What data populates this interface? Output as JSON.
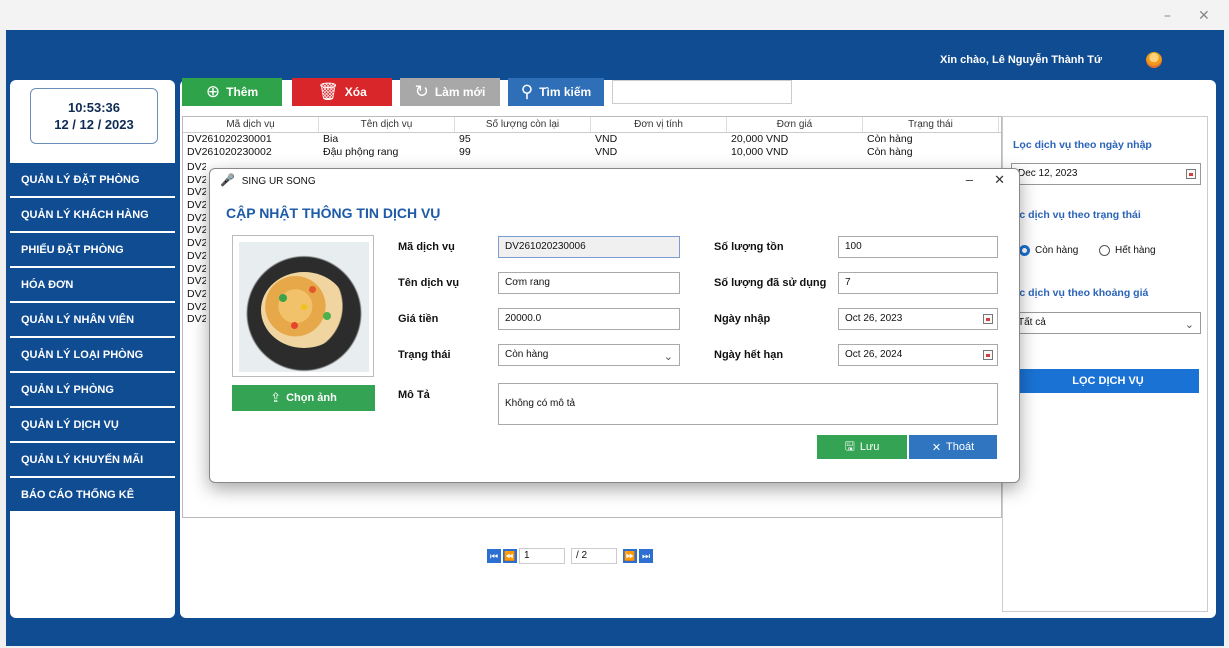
{
  "window": {
    "minimize": "–",
    "close": "✕"
  },
  "header": {
    "greeting": "Xin chào,",
    "user_name": "Lê Nguyễn Thành Tứ"
  },
  "clock": {
    "time": "10:53:36",
    "date": "12 / 12 / 2023"
  },
  "sidebar": {
    "items": [
      {
        "label": "QUẢN LÝ ĐẶT PHÒNG"
      },
      {
        "label": "QUẢN LÝ KHÁCH HÀNG"
      },
      {
        "label": "PHIẾU ĐẶT PHÒNG"
      },
      {
        "label": "HÓA ĐƠN"
      },
      {
        "label": "QUẢN LÝ NHÂN VIÊN"
      },
      {
        "label": "QUẢN LÝ LOẠI PHÒNG"
      },
      {
        "label": "QUẢN LÝ PHÒNG"
      },
      {
        "label": "QUẢN LÝ DỊCH VỤ"
      },
      {
        "label": "QUẢN LÝ KHUYẾN MÃI"
      },
      {
        "label": "BÁO CÁO THỐNG KÊ"
      }
    ]
  },
  "toolbar": {
    "add_label": "Thêm",
    "delete_label": "Xóa",
    "refresh_label": "Làm mới",
    "search_label": "Tìm kiếm",
    "search_value": ""
  },
  "table": {
    "headers": [
      "Mã dịch vụ",
      "Tên dịch vụ",
      "Số lượng còn lại",
      "Đơn vị tính",
      "Đơn giá",
      "Trạng thái"
    ],
    "rows": [
      [
        "DV261020230001",
        "Bia",
        "95",
        "VND",
        "20,000 VND",
        "Còn hàng"
      ],
      [
        "DV261020230002",
        "Đậu phộng rang",
        "99",
        "VND",
        "10,000 VND",
        "Còn hàng"
      ]
    ],
    "partial_ids": [
      "DV26",
      "DV26",
      "DV26",
      "DV26",
      "DV26",
      "DV26",
      "DV27",
      "DV27",
      "DV27",
      "DV27",
      "DV27",
      "DV27",
      "DV27"
    ]
  },
  "pagination": {
    "current": "1",
    "total": "/ 2"
  },
  "filter": {
    "by_date_title": "Lọc dịch vụ theo ngày nhập",
    "date_value": "Dec 12, 2023",
    "by_status_title": "ọc dịch vụ theo trạng thái",
    "status_in_stock": "Còn hàng",
    "status_out_of_stock": "Hết hàng",
    "by_price_title": "ọc dịch vụ theo khoảng giá",
    "price_value": "Tất cả",
    "filter_button": "LỌC DỊCH VỤ"
  },
  "dialog": {
    "window_title": "SING UR SONG",
    "heading": "CẬP NHẬT THÔNG TIN DỊCH VỤ",
    "choose_image": "Chọn ảnh",
    "fields": {
      "code_label": "Mã dịch vụ",
      "code_value": "DV261020230006",
      "name_label": "Tên dịch vụ",
      "name_value": "Cơm rang",
      "price_label": "Giá tiền",
      "price_value": "20000.0",
      "status_label": "Trạng thái",
      "status_value": "Còn hàng",
      "stock_label": "Số lượng tồn",
      "stock_value": "100",
      "used_label": "Số lượng đã sử dụng",
      "used_value": "7",
      "import_date_label": "Ngày nhập",
      "import_date_value": "Oct 26, 2023",
      "expiry_label": "Ngày hết hạn",
      "expiry_value": "Oct 26, 2024",
      "desc_label": "Mô Tả",
      "desc_value": "Không có mô tả"
    },
    "save_label": "Lưu",
    "exit_label": "Thoát"
  },
  "colors": {
    "brand": "#0f4c92",
    "add": "#2fa34a",
    "delete": "#d9262b",
    "refresh": "#a8a8a8",
    "search": "#2f6fb8",
    "accent": "#1a73d4"
  }
}
